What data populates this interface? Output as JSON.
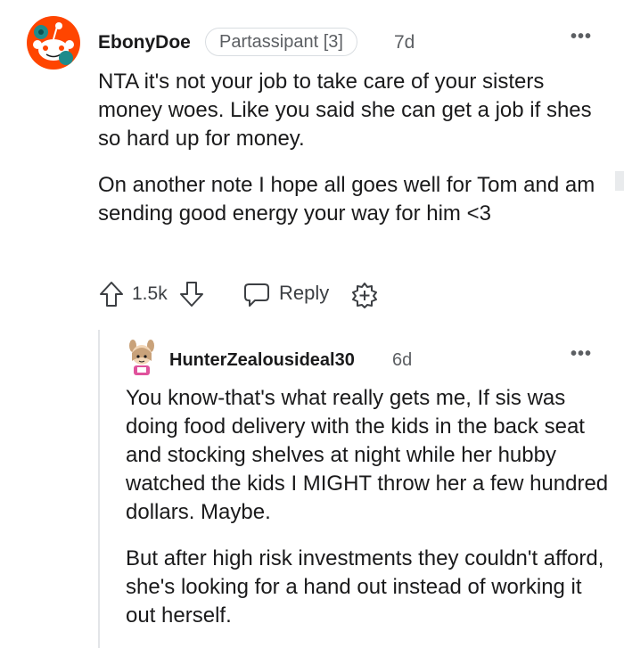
{
  "comments": [
    {
      "username": "EbonyDoe",
      "flair": "Partassipant [3]",
      "time": "7d",
      "more": "•••",
      "paragraphs": [
        "NTA it's not your job to take care of your sisters money woes. Like you said she can get a job if shes so hard up for money.",
        "On another note I hope all goes well for Tom and am sending good energy your way for him <3"
      ],
      "votes": "1.5k",
      "reply_label": "Reply",
      "avatar_icon": "snoo-avatar-icon"
    },
    {
      "username": "HunterZealousideal30",
      "time": "6d",
      "more": "•••",
      "paragraphs": [
        "You know-that's what really gets me, If sis was doing food delivery with the kids in the back seat and stocking shelves at night while her hubby watched the kids I MIGHT throw her a few hundred dollars. Maybe.",
        "But after high risk investments they couldn't afford, she's looking for a hand out instead of working it out herself."
      ],
      "avatar_icon": "cartoon-avatar-icon"
    }
  ],
  "colors": {
    "reddit_orange": "#ff4500",
    "text": "#1a1a1b",
    "meta": "#5c5f63",
    "thread_line": "#e3e5e8"
  }
}
